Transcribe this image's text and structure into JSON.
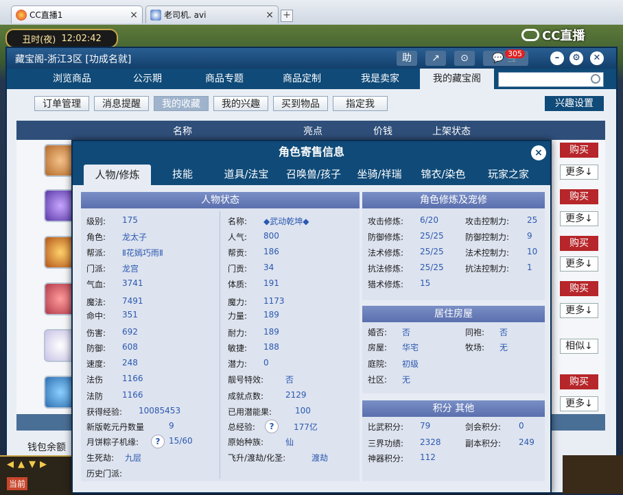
{
  "browser": {
    "tabs": [
      {
        "label": "CC直播1",
        "close": "×"
      },
      {
        "label": "老司机. avi",
        "close": "×"
      }
    ],
    "add_tab": "+"
  },
  "game": {
    "clock_period": "丑时(夜)",
    "clock_time": "12:02:42",
    "cc_logo": "CC直播",
    "hud_current": "当前",
    "hud_arrows": "◀▲▼▶"
  },
  "cbg": {
    "title": "藏宝阁-浙江3区 [功成名就]",
    "tool_buttons": [
      "助",
      "↗",
      "⊙"
    ],
    "message_count": "305",
    "nav": [
      "浏览商品",
      "公示期",
      "商品专题",
      "商品定制",
      "我是卖家",
      "我的藏宝阁"
    ],
    "subnav": [
      "订单管理",
      "消息提醒",
      "我的收藏",
      "我的兴趣",
      "买到物品",
      "指定我"
    ],
    "interest_settings": "兴趣设置",
    "list_headers": [
      "名称",
      "亮点",
      "价钱",
      "上架状态"
    ],
    "buy_label": "购买",
    "more_label": "更多↓",
    "similar_label": "相似↓",
    "wallet_label": "钱包余额"
  },
  "modal": {
    "title": "角色寄售信息",
    "close": "×",
    "tabs": [
      "人物/修炼",
      "技能",
      "道具/法宝",
      "召唤兽/孩子",
      "坐骑/祥瑞",
      "锦衣/染色",
      "玩家之家"
    ],
    "char_status": {
      "title": "人物状态",
      "left": [
        {
          "k": "级别:",
          "v": "175"
        },
        {
          "k": "角色:",
          "v": "龙太子"
        },
        {
          "k": "帮派:",
          "v": "Ⅱ花嫣巧雨Ⅱ"
        },
        {
          "k": "门派:",
          "v": "龙宫"
        },
        {
          "k": "气血:",
          "v": "3741"
        },
        {
          "k": "魔法:",
          "v": "7491"
        },
        {
          "k": "命中:",
          "v": "351"
        },
        {
          "k": "伤害:",
          "v": "692"
        },
        {
          "k": "防御:",
          "v": "608"
        },
        {
          "k": "速度:",
          "v": "248"
        },
        {
          "k": "法伤",
          "v": "1166"
        },
        {
          "k": "法防",
          "v": "1166"
        },
        {
          "k": "获得经验:",
          "v": "10085453"
        },
        {
          "k": "新版乾元丹数量",
          "v": "9"
        },
        {
          "k": "月饼粽子机缘:",
          "v": "15/60"
        },
        {
          "k": "生死劫:",
          "v": "九层"
        },
        {
          "k": "历史门派:",
          "v": ""
        }
      ],
      "right": [
        {
          "k": "名称:",
          "v": "◆武动乾坤◆"
        },
        {
          "k": "人气:",
          "v": "800"
        },
        {
          "k": "帮贡:",
          "v": "186"
        },
        {
          "k": "门贡:",
          "v": "34"
        },
        {
          "k": "体质:",
          "v": "191"
        },
        {
          "k": "魔力:",
          "v": "1173"
        },
        {
          "k": "力量:",
          "v": "189"
        },
        {
          "k": "耐力:",
          "v": "189"
        },
        {
          "k": "敏捷:",
          "v": "188"
        },
        {
          "k": "潜力:",
          "v": "0"
        },
        {
          "k": "靓号特效:",
          "v": "否"
        },
        {
          "k": "成就点数:",
          "v": "2129"
        },
        {
          "k": "已用潜能果:",
          "v": "100"
        },
        {
          "k": "总经验:",
          "v": "177亿"
        },
        {
          "k": "原始种族:",
          "v": "仙"
        },
        {
          "k": "飞升/渡劫/化圣:",
          "v": "渡劫"
        }
      ],
      "help_mark": "?"
    },
    "cultivation": {
      "title": "角色修炼及宠修",
      "rows": [
        {
          "k1": "攻击修炼:",
          "v1": "6/20",
          "k2": "攻击控制力:",
          "v2": "25"
        },
        {
          "k1": "防御修炼:",
          "v1": "25/25",
          "k2": "防御控制力:",
          "v2": "9"
        },
        {
          "k1": "法术修炼:",
          "v1": "25/25",
          "k2": "法术控制力:",
          "v2": "10"
        },
        {
          "k1": "抗法修炼:",
          "v1": "25/25",
          "k2": "抗法控制力:",
          "v2": "1"
        },
        {
          "k1": "猎术修炼:",
          "v1": "15",
          "k2": "",
          "v2": ""
        }
      ]
    },
    "housing": {
      "title": "居住房屋",
      "rows": [
        {
          "k1": "婚否:",
          "v1": "否",
          "k2": "同袍:",
          "v2": "否"
        },
        {
          "k1": "房屋:",
          "v1": "华宅",
          "k2": "牧场:",
          "v2": "无"
        },
        {
          "k1": "庭院:",
          "v1": "初级",
          "k2": "",
          "v2": ""
        },
        {
          "k1": "社区:",
          "v1": "无",
          "k2": "",
          "v2": ""
        }
      ]
    },
    "points": {
      "title": "积分 其他",
      "rows": [
        {
          "k1": "比武积分:",
          "v1": "79",
          "k2": "剑会积分:",
          "v2": "0"
        },
        {
          "k1": "三界功绩:",
          "v1": "2328",
          "k2": "副本积分:",
          "v2": "249"
        },
        {
          "k1": "神器积分:",
          "v1": "112",
          "k2": "",
          "v2": ""
        }
      ]
    }
  }
}
